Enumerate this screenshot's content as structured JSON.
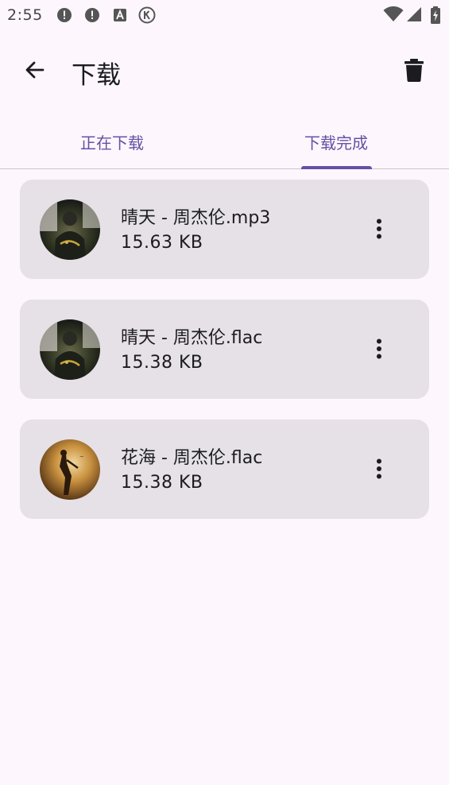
{
  "status_bar": {
    "time": "2:55",
    "icons_left": [
      "alert-circle-icon",
      "alert-circle-icon",
      "font-a-icon",
      "k-circle-icon"
    ],
    "icons_right": [
      "wifi-icon",
      "signal-icon",
      "battery-charging-icon"
    ]
  },
  "app_bar": {
    "title": "下载",
    "back_icon": "arrow-back-icon",
    "action_icon": "trash-icon"
  },
  "tabs": [
    {
      "label": "正在下载",
      "selected": false
    },
    {
      "label": "下载完成",
      "selected": true
    }
  ],
  "downloads": [
    {
      "name": "晴天 - 周杰伦.mp3",
      "size": "15.63 KB",
      "cover": "album-cover-dark"
    },
    {
      "name": "晴天 - 周杰伦.flac",
      "size": "15.38 KB",
      "cover": "album-cover-dark"
    },
    {
      "name": "花海 - 周杰伦.flac",
      "size": "15.38 KB",
      "cover": "album-cover-gold"
    }
  ],
  "colors": {
    "background": "#fdf7fd",
    "accent": "#6750a4",
    "card": "#e5e1e6",
    "text": "#1c1b1f"
  }
}
